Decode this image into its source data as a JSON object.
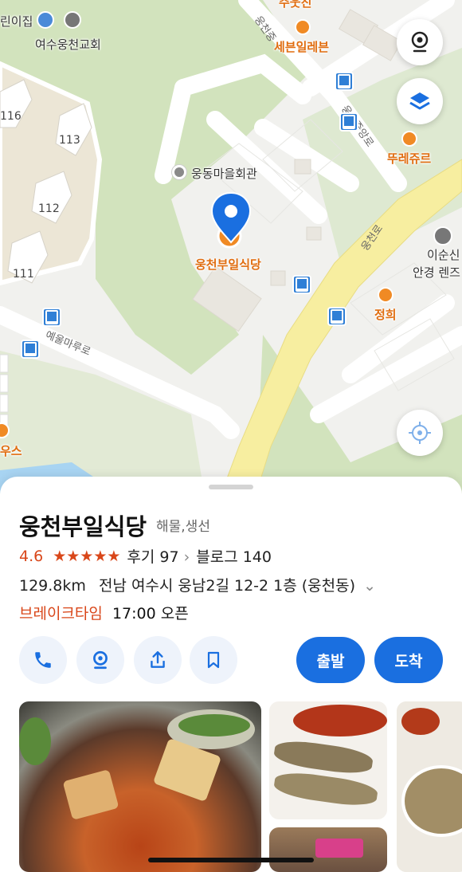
{
  "map": {
    "pois": {
      "church": "여수웅천교회",
      "church_partial": "린이집",
      "village_hall": "웅동마을회관",
      "restaurant": "웅천부일식당",
      "seven_eleven": "세븐일레븐",
      "tous": "뚜레쥬르",
      "jeonghui": "정희",
      "glasses_line1": "이순신",
      "glasses_line2": "안경 렌즈",
      "top_partial": "주웃진",
      "left_partial": "우스"
    },
    "building_numbers": [
      "116",
      "113",
      "112",
      "111"
    ],
    "roads": {
      "yeulmaru": "예울마루로",
      "ungcheon": "웅천로",
      "ungcheon_jungang": "웅천중앙로",
      "ungcheon_top": "웅천중"
    },
    "buttons": {
      "streetview_icon": "streetview-icon",
      "layers_icon": "layers-icon",
      "location_icon": "crosshair-icon"
    }
  },
  "place": {
    "name": "웅천부일식당",
    "category": "해물,생선",
    "rating": "4.6",
    "rating_value": 4.6,
    "stars": "★★★★★",
    "reviews": "후기 97",
    "blog": "블로그 140",
    "distance": "129.8km",
    "address": "전남 여수시 웅남2길 12-2 1층 (웅천동)",
    "hours_status": "브레이크타임",
    "hours_next": "17:00 오픈"
  },
  "actions": {
    "call_icon": "phone-icon",
    "map_icon": "map-pin-icon",
    "share_icon": "share-icon",
    "save_icon": "bookmark-icon",
    "depart": "출발",
    "arrive": "도착"
  },
  "colors": {
    "accent_blue": "#1a6fe0",
    "rating_red": "#d9471a",
    "park_green": "#cfe0b8",
    "road_yellow": "#f7eea0"
  }
}
